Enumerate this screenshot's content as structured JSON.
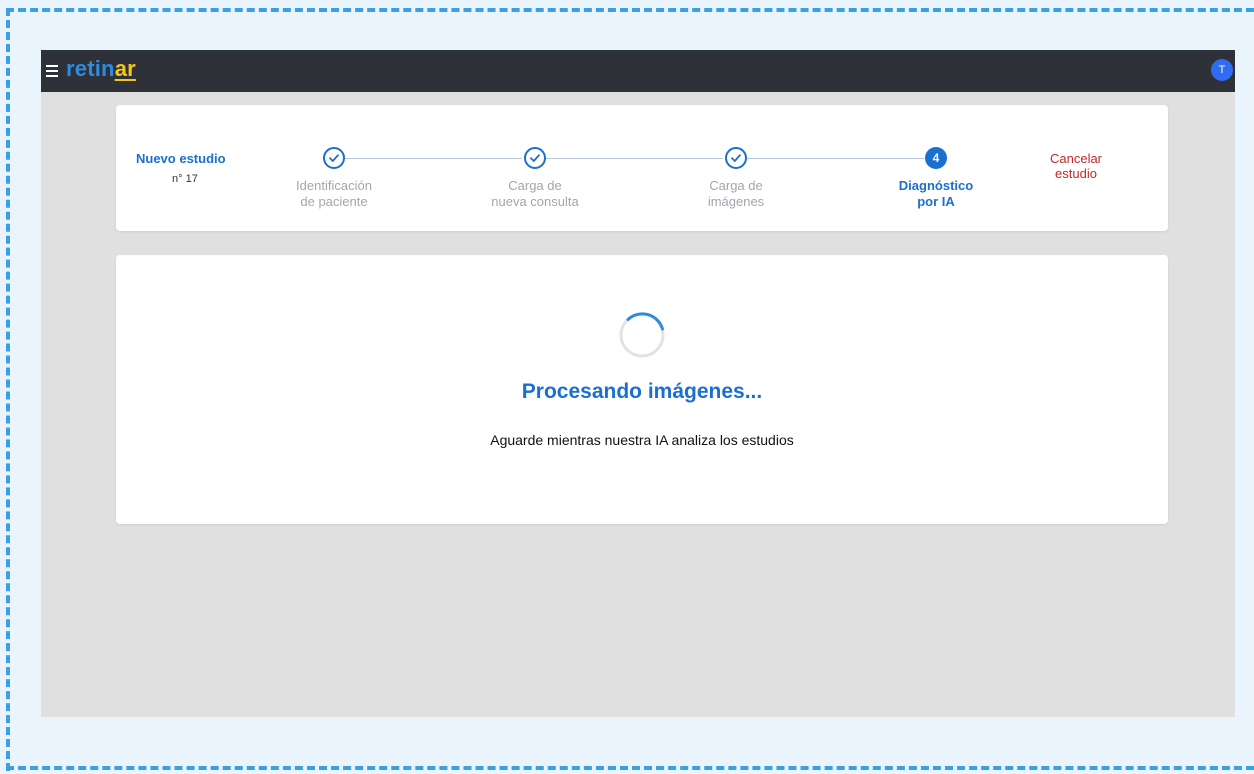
{
  "app": {
    "logo_part1": "retin",
    "logo_part2": "ar",
    "avatar_initial": "T",
    "colors": {
      "topbar": "#2f3138",
      "accent": "#1b6fd0",
      "logo_blue": "#2d8ce0",
      "logo_yellow": "#f2c521",
      "danger": "#c62828"
    }
  },
  "study": {
    "title": "Nuevo estudio",
    "number": "n° 17"
  },
  "steps": [
    {
      "line1": "Identificación",
      "line2": "de paciente",
      "state": "done",
      "icon": "check-icon"
    },
    {
      "line1": "Carga de",
      "line2": "nueva consulta",
      "state": "done",
      "icon": "check-icon"
    },
    {
      "line1": "Carga de",
      "line2": "imágenes",
      "state": "done",
      "icon": "check-icon"
    },
    {
      "line1": "Diagnóstico",
      "line2": "por IA",
      "state": "active",
      "number": "4"
    }
  ],
  "cancel": {
    "line1": "Cancelar",
    "line2": "estudio"
  },
  "processing": {
    "title": "Procesando imágenes...",
    "subtitle": "Aguarde mientras nuestra IA analiza los estudios",
    "icon": "loading-spinner-icon"
  }
}
